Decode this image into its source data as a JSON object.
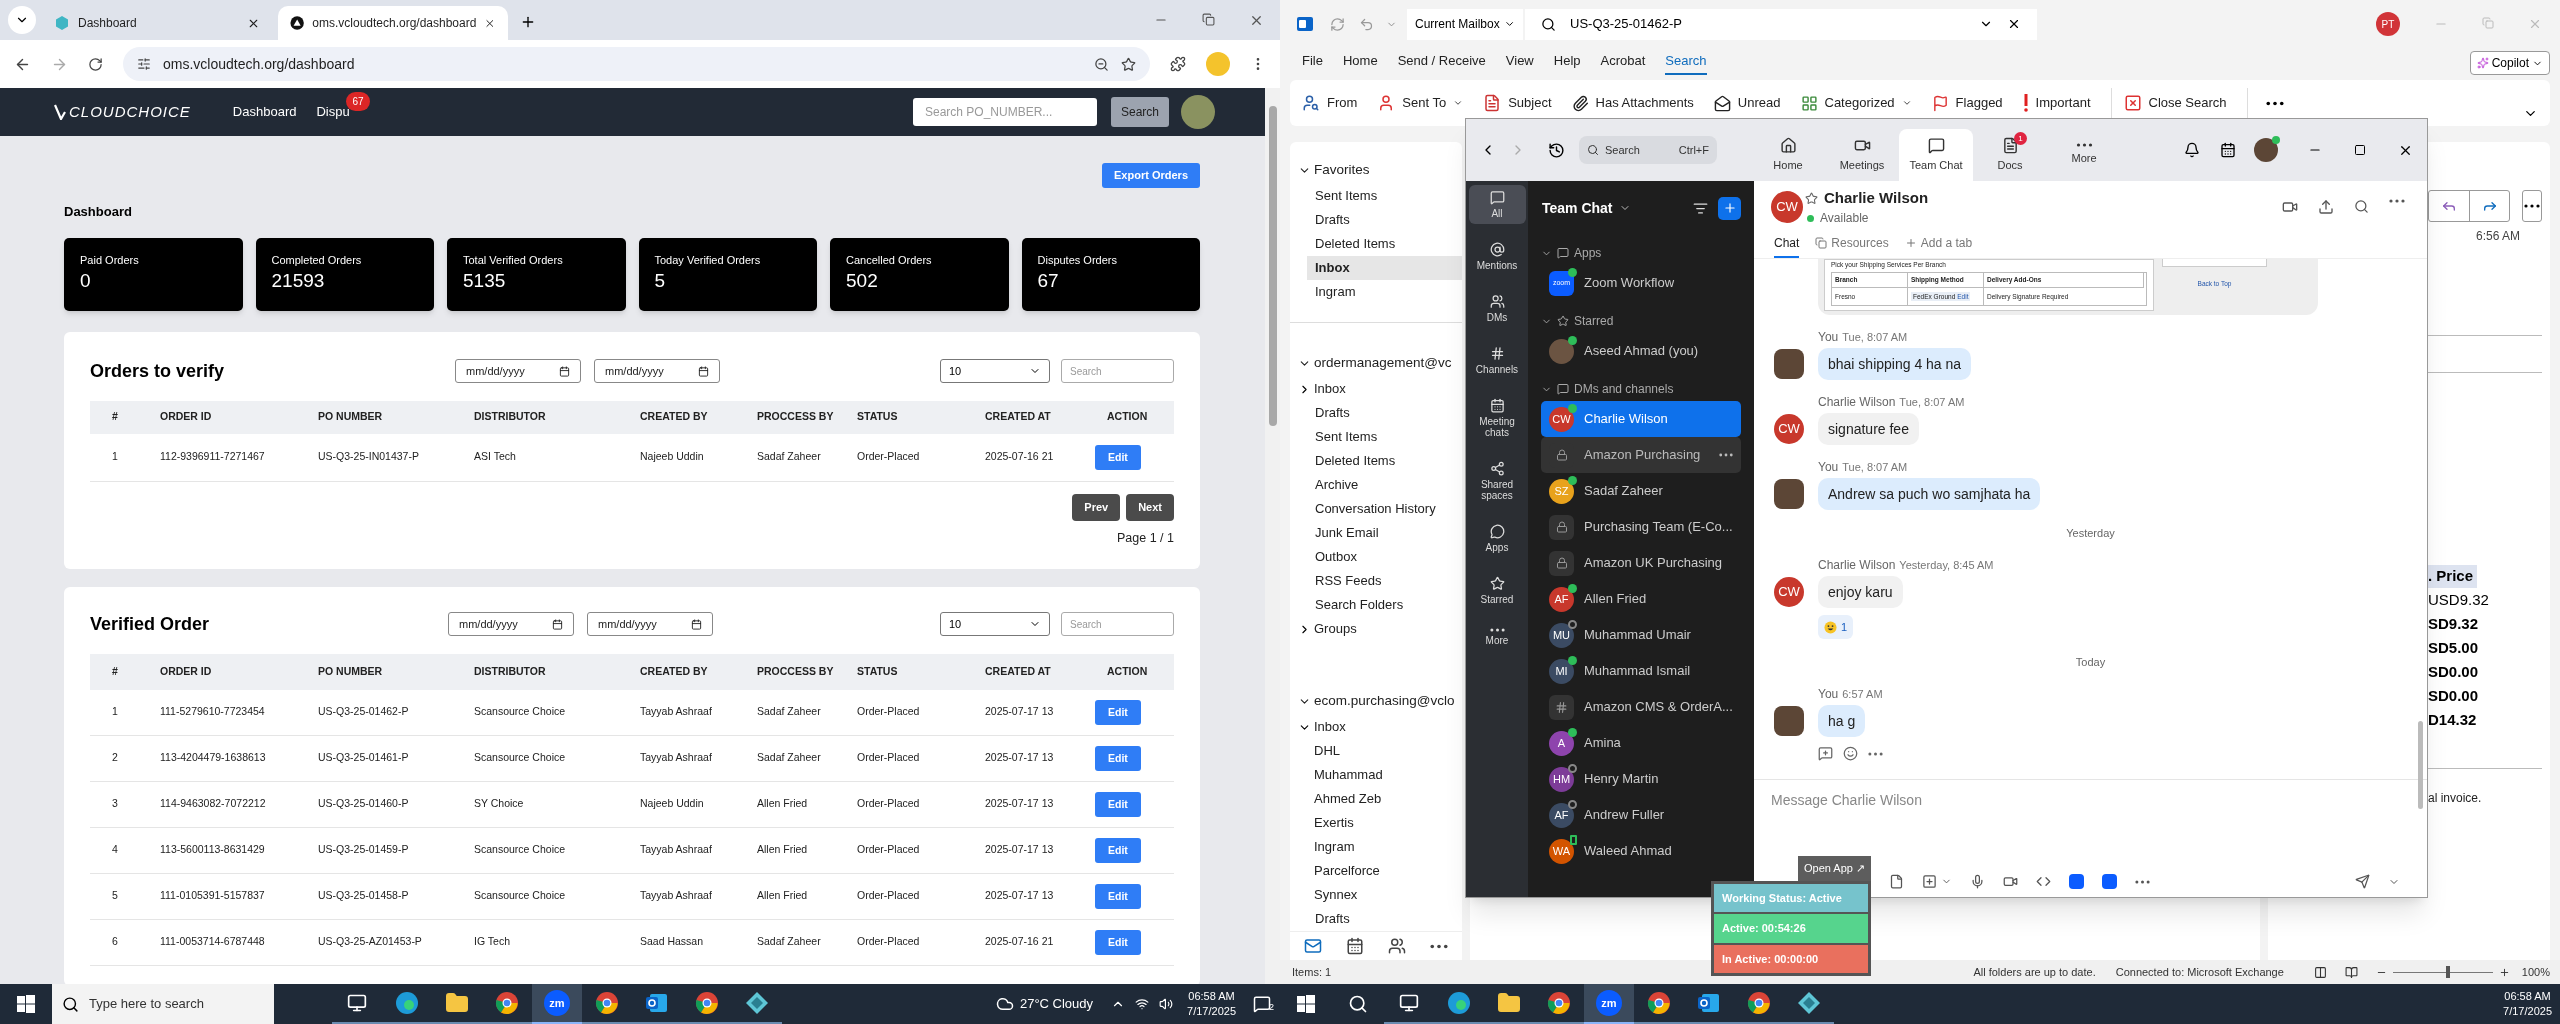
{
  "browser": {
    "tabs": [
      {
        "title": "Dashboard",
        "selected": false
      },
      {
        "title": "oms.vcloudtech.org/dashboard",
        "selected": true
      }
    ],
    "address": "oms.vcloudtech.org/dashboard"
  },
  "app": {
    "logo": "CLOUDCHOICE",
    "nav": [
      {
        "label": "Dashboard"
      },
      {
        "label": "Dispu",
        "badge": "67"
      }
    ],
    "search": {
      "placeholder": "Search PO_NUMBER...",
      "button": "Search"
    }
  },
  "export_button": "Export Orders",
  "page_title": "Dashboard",
  "stats": [
    {
      "label": "Paid Orders",
      "value": "0"
    },
    {
      "label": "Completed Orders",
      "value": "21593"
    },
    {
      "label": "Total Verified Orders",
      "value": "5135"
    },
    {
      "label": "Today Verified Orders",
      "value": "5"
    },
    {
      "label": "Cancelled Orders",
      "value": "502"
    },
    {
      "label": "Disputes Orders",
      "value": "67"
    }
  ],
  "panels": [
    {
      "title": "Orders to verify",
      "date_from": "mm/dd/yyyy",
      "date_to": "mm/dd/yyyy",
      "page_size": "10",
      "search_placeholder": "Search",
      "columns": [
        "#",
        "ORDER ID",
        "PO NUMBER",
        "DISTRIBUTOR",
        "CREATED BY",
        "PROCCESS BY",
        "STATUS",
        "CREATED AT",
        "ACTION"
      ],
      "rows": [
        [
          "1",
          "112-9396911-7271467",
          "US-Q3-25-IN01437-P",
          "ASI Tech",
          "Najeeb Uddin",
          "Sadaf Zaheer",
          "Order-Placed",
          "2025-07-16 21",
          "Edit"
        ]
      ],
      "pagination": {
        "prev": "Prev",
        "next": "Next",
        "page": "Page 1 / 1"
      }
    },
    {
      "title": "Verified Order",
      "date_from": "mm/dd/yyyy",
      "date_to": "mm/dd/yyyy",
      "page_size": "10",
      "search_placeholder": "Search",
      "columns": [
        "#",
        "ORDER ID",
        "PO NUMBER",
        "DISTRIBUTOR",
        "CREATED BY",
        "PROCCESS BY",
        "STATUS",
        "CREATED AT",
        "ACTION"
      ],
      "rows": [
        [
          "1",
          "111-5279610-7723454",
          "US-Q3-25-01462-P",
          "Scansource Choice",
          "Tayyab Ashraaf",
          "Sadaf Zaheer",
          "Order-Placed",
          "2025-07-17 13",
          "Edit"
        ],
        [
          "2",
          "113-4204479-1638613",
          "US-Q3-25-01461-P",
          "Scansource Choice",
          "Tayyab Ashraaf",
          "Sadaf Zaheer",
          "Order-Placed",
          "2025-07-17 13",
          "Edit"
        ],
        [
          "3",
          "114-9463082-7072212",
          "US-Q3-25-01460-P",
          "SY Choice",
          "Najeeb Uddin",
          "Allen Fried",
          "Order-Placed",
          "2025-07-17 13",
          "Edit"
        ],
        [
          "4",
          "113-5600113-8631429",
          "US-Q3-25-01459-P",
          "Scansource Choice",
          "Tayyab Ashraaf",
          "Allen Fried",
          "Order-Placed",
          "2025-07-17 13",
          "Edit"
        ],
        [
          "5",
          "111-0105391-5157837",
          "US-Q3-25-01458-P",
          "Scansource Choice",
          "Tayyab Ashraaf",
          "Allen Fried",
          "Order-Placed",
          "2025-07-17 13",
          "Edit"
        ],
        [
          "6",
          "111-0053714-6787448",
          "US-Q3-25-AZ01453-P",
          "IG Tech",
          "Saad Hassan",
          "Sadaf Zaheer",
          "Order-Placed",
          "2025-07-16 21",
          "Edit"
        ]
      ]
    }
  ],
  "outlook": {
    "scope": "Current Mailbox",
    "search_value": "US-Q3-25-01462-P",
    "profile": "PT",
    "menu": [
      {
        "label": "File",
        "selected": false
      },
      {
        "label": "Home",
        "selected": false
      },
      {
        "label": "Send / Receive",
        "selected": false
      },
      {
        "label": "View",
        "selected": false
      },
      {
        "label": "Help",
        "selected": false
      },
      {
        "label": "Acrobat",
        "selected": false
      },
      {
        "label": "Search",
        "selected": true
      }
    ],
    "copilot": "Copilot",
    "ribbon": [
      {
        "label": "From",
        "dropdown": false
      },
      {
        "label": "Sent To",
        "dropdown": true
      },
      {
        "label": "Subject",
        "dropdown": false
      },
      {
        "label": "Has Attachments",
        "dropdown": false
      },
      {
        "label": "Unread",
        "dropdown": false
      },
      {
        "label": "Categorized",
        "dropdown": true
      },
      {
        "label": "Flagged",
        "dropdown": false
      },
      {
        "label": "Important",
        "dropdown": false
      },
      {
        "label": "Close Search",
        "dropdown": false
      }
    ],
    "folders": [
      {
        "name": "Favorites",
        "expanded": true,
        "children": [
          {
            "name": "Sent Items",
            "selected": false
          },
          {
            "name": "Drafts",
            "selected": false
          },
          {
            "name": "Deleted Items",
            "selected": false
          },
          {
            "name": "Inbox",
            "selected": true
          },
          {
            "name": "Ingram",
            "selected": false
          }
        ]
      },
      {
        "name": "ordermanagement@vc",
        "expanded": true,
        "children": [
          {
            "name": "Inbox",
            "selected": false,
            "expanded": false
          },
          {
            "name": "Drafts",
            "selected": false
          },
          {
            "name": "Sent Items",
            "selected": false
          },
          {
            "name": "Deleted Items",
            "selected": false
          },
          {
            "name": "Archive",
            "selected": false
          },
          {
            "name": "Conversation History",
            "selected": false
          },
          {
            "name": "Junk Email",
            "selected": false
          },
          {
            "name": "Outbox",
            "selected": false
          },
          {
            "name": "RSS Feeds",
            "selected": false
          },
          {
            "name": "Search Folders",
            "selected": false
          },
          {
            "name": "Groups",
            "selected": false,
            "expanded": false
          }
        ]
      },
      {
        "name": "ecom.purchasing@vclo",
        "expanded": true,
        "children": [
          {
            "name": "Inbox",
            "selected": false,
            "expanded": true,
            "children": [
              {
                "name": "DHL",
                "selected": false
              },
              {
                "name": "Muhammad",
                "selected": false
              },
              {
                "name": "Ahmed Zeb",
                "selected": false
              },
              {
                "name": "Exertis",
                "selected": false
              },
              {
                "name": "Ingram",
                "selected": false
              },
              {
                "name": "Parcelforce",
                "selected": false
              },
              {
                "name": "Synnex",
                "selected": false
              }
            ]
          },
          {
            "name": "Drafts",
            "selected": false
          }
        ]
      }
    ],
    "reading": {
      "time": "6:56 AM",
      "price": ". Price",
      "amounts": [
        {
          "text": "USD9.32",
          "bold": false
        },
        {
          "text": "SD9.32",
          "bold": true
        },
        {
          "text": "SD5.00",
          "bold": true
        },
        {
          "text": "SD0.00",
          "bold": true
        },
        {
          "text": "SD0.00",
          "bold": true
        },
        {
          "text": "D14.32",
          "bold": true
        }
      ],
      "note": "al invoice."
    },
    "status": {
      "items": "Items: 1",
      "sync": "All folders are up to date.",
      "connection": "Connected to: Microsoft Exchange",
      "zoom": "100%",
      "level": 0.55
    }
  },
  "zoom": {
    "search": {
      "placeholder": "Search",
      "shortcut": "Ctrl+F"
    },
    "tabs": [
      {
        "label": "Home",
        "selected": false
      },
      {
        "label": "Meetings",
        "selected": false
      },
      {
        "label": "Team Chat",
        "selected": true
      },
      {
        "label": "Docs",
        "selected": false,
        "badge": "1"
      },
      {
        "label": "More",
        "selected": false
      }
    ],
    "rail": [
      {
        "label": "All",
        "selected": true
      },
      {
        "label": "Mentions",
        "selected": false
      },
      {
        "label": "DMs",
        "selected": false
      },
      {
        "label": "Channels",
        "selected": false
      },
      {
        "label": "Meeting chats",
        "selected": false
      },
      {
        "label": "Shared spaces",
        "selected": false
      },
      {
        "label": "Apps",
        "selected": false
      },
      {
        "label": "Starred",
        "selected": false
      },
      {
        "label": "More",
        "selected": false
      }
    ],
    "list_title": "Team Chat",
    "sections": [
      {
        "title": "Apps",
        "expanded": true,
        "items": [
          {
            "kind": "app",
            "icon_text": "zoom",
            "name": "Zoom Workflow",
            "online": true,
            "mobile": false,
            "selected": false,
            "hovered": false
          }
        ]
      },
      {
        "title": "Starred",
        "expanded": true,
        "items": [
          {
            "kind": "photo",
            "name": "Aseed Ahmad (you)",
            "online": true,
            "mobile": false,
            "selected": false,
            "hovered": false
          }
        ]
      },
      {
        "title": "DMs and channels",
        "expanded": true,
        "items": [
          {
            "kind": "initials",
            "initials": "CW",
            "color": "#c8382c",
            "name": "Charlie Wilson",
            "online": true,
            "mobile": false,
            "selected": true,
            "hovered": false
          },
          {
            "kind": "private",
            "name": "Amazon Purchasing",
            "selected": false,
            "hovered": true
          },
          {
            "kind": "initials",
            "initials": "SZ",
            "color": "#e8a21c",
            "name": "Sadaf Zaheer",
            "online": true,
            "mobile": false,
            "selected": false,
            "hovered": false
          },
          {
            "kind": "private",
            "name": "Purchasing Team (E-Co...",
            "selected": false,
            "hovered": false
          },
          {
            "kind": "private",
            "name": "Amazon UK Purchasing",
            "selected": false,
            "hovered": false
          },
          {
            "kind": "initials",
            "initials": "AF",
            "color": "#c8382c",
            "name": "Allen Fried",
            "online": true,
            "mobile": false,
            "selected": false,
            "hovered": false
          },
          {
            "kind": "initials",
            "initials": "MU",
            "color": "#3b4b63",
            "name": "Muhammad Umair",
            "online": false,
            "mobile": false,
            "selected": false,
            "hovered": false
          },
          {
            "kind": "initials",
            "initials": "MI",
            "color": "#3b4b63",
            "name": "Muhammad Ismail",
            "online": true,
            "mobile": false,
            "selected": false,
            "hovered": false
          },
          {
            "kind": "channel",
            "name": "Amazon CMS & OrderA...",
            "selected": false,
            "hovered": false
          },
          {
            "kind": "initials",
            "initials": "A",
            "color": "#8e44ad",
            "name": "Amina",
            "online": true,
            "mobile": false,
            "selected": false,
            "hovered": false
          },
          {
            "kind": "initials",
            "initials": "HM",
            "color": "#7d3c98",
            "name": "Henry Martin",
            "online": false,
            "mobile": false,
            "selected": false,
            "hovered": false
          },
          {
            "kind": "initials",
            "initials": "AF",
            "color": "#3b4b63",
            "name": "Andrew Fuller",
            "online": false,
            "mobile": false,
            "selected": false,
            "hovered": false
          },
          {
            "kind": "initials",
            "initials": "WA",
            "color": "#d35400",
            "name": "Waleed Ahmad",
            "online": true,
            "mobile": true,
            "selected": false,
            "hovered": false
          }
        ]
      }
    ],
    "contact": {
      "initials": "CW",
      "name": "Charlie Wilson",
      "status": "Available"
    },
    "chat_tabs": [
      {
        "label": "Chat",
        "selected": true
      },
      {
        "label": "Resources",
        "selected": false
      }
    ],
    "add_tab": "Add a tab",
    "messages": [
      {
        "kind": "image",
        "heading": "Pick your Shipping Services Per Branch",
        "columns": [
          "Branch",
          "Shipping Method",
          "Delivery Add-Ons"
        ],
        "cells": [
          "Fresno",
          "FedEx Ground",
          "Edit",
          "Delivery Signature Required"
        ],
        "link": "Back to Top"
      },
      {
        "kind": "message",
        "mine": true,
        "sender": "You",
        "time": "Tue, 8:07 AM",
        "text": "bhai shipping 4 ha na",
        "hover_actions": false
      },
      {
        "kind": "message",
        "mine": false,
        "sender": "Charlie Wilson",
        "time": "Tue, 8:07 AM",
        "text": "signature fee",
        "initials": "CW",
        "hover_actions": false
      },
      {
        "kind": "message",
        "mine": true,
        "sender": "You",
        "time": "Tue, 8:07 AM",
        "text": "Andrew sa puch wo samjhata ha",
        "hover_actions": false
      },
      {
        "kind": "divider",
        "text": "Yesterday"
      },
      {
        "kind": "message",
        "mine": false,
        "sender": "Charlie Wilson",
        "time": "Yesterday, 8:45 AM",
        "text": "enjoy karu",
        "initials": "CW",
        "reaction_count": "1",
        "hover_actions": false
      },
      {
        "kind": "divider",
        "text": "Today"
      },
      {
        "kind": "message",
        "mine": true,
        "sender": "You",
        "time": "6:57 AM",
        "text": "ha g",
        "hover_actions": true
      }
    ],
    "composer_placeholder": "Message Charlie Wilson"
  },
  "widget": {
    "open_app": "Open App ↗",
    "working": "Working Status: Active",
    "active": "Active: 00:54:26",
    "inactive": "In Active: 00:00:00"
  },
  "taskbars": [
    {
      "search_placeholder": "Type here to search",
      "apps": [
        {
          "kind": "taskview",
          "active": false
        },
        {
          "kind": "edge",
          "active": false
        },
        {
          "kind": "explorer",
          "active": false
        },
        {
          "kind": "chrome",
          "active": false
        },
        {
          "kind": "zoom",
          "label": "zm",
          "active": true
        },
        {
          "kind": "chrome",
          "active": false
        },
        {
          "kind": "outlook",
          "active": false
        },
        {
          "kind": "chrome",
          "active": false
        },
        {
          "kind": "app",
          "active": false
        }
      ],
      "weather": "27°C Cloudy",
      "time": "06:58 AM",
      "date": "7/17/2025",
      "notifications": "2"
    },
    {
      "apps": [
        {
          "kind": "taskview",
          "active": false
        },
        {
          "kind": "edge",
          "active": false
        },
        {
          "kind": "explorer",
          "active": false
        },
        {
          "kind": "chrome",
          "active": false
        },
        {
          "kind": "zoom",
          "label": "zm",
          "active": true
        },
        {
          "kind": "chrome",
          "active": false
        },
        {
          "kind": "outlook",
          "active": false
        },
        {
          "kind": "chrome",
          "active": false
        },
        {
          "kind": "app",
          "active": false
        }
      ],
      "time": "06:58 AM",
      "date": "7/17/2025"
    }
  ]
}
